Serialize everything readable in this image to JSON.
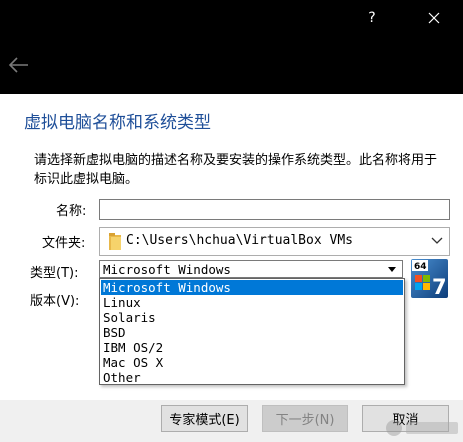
{
  "titlebar": {
    "help_label": "?",
    "close_icon": "close-icon",
    "background": "#000000"
  },
  "backbar": {
    "back_icon": "back-arrow-icon"
  },
  "dialog": {
    "heading": "虚拟电脑名称和系统类型",
    "description": "请选择新虚拟电脑的描述名称及要安装的操作系统类型。此名称将用于标识此虚拟电脑。",
    "heading_color": "#1f4f99"
  },
  "form": {
    "name_label": "名称:",
    "name_value": "",
    "folder_label": "文件夹:",
    "folder_value": "C:\\Users\\hchua\\VirtualBox VMs",
    "type_label": "类型(T):",
    "type_value": "Microsoft Windows",
    "version_label": "版本(V):",
    "type_options": [
      "Microsoft Windows",
      "Linux",
      "Solaris",
      "BSD",
      "IBM OS/2",
      "Mac OS X",
      "Other"
    ],
    "selected_index": 0,
    "os_badge": {
      "top_label": "64",
      "version_label": "7",
      "icon": "windows-7-64-icon"
    }
  },
  "buttons": {
    "expert": "专家模式(E)",
    "next": "下一步(N)",
    "cancel": "取消"
  },
  "colors": {
    "selection": "#0078d7",
    "button_face": "#e1e1e1",
    "disabled_text": "#838383"
  }
}
